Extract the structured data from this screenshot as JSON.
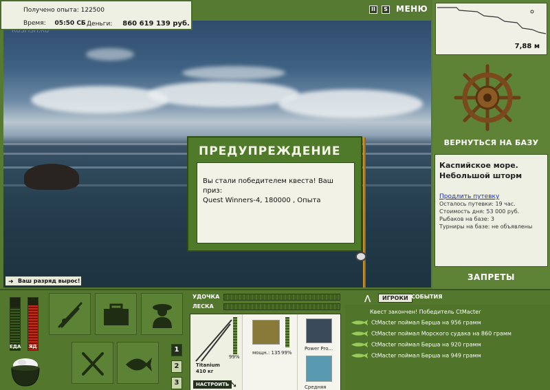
{
  "stats": {
    "xp_label": "Получено опыта:",
    "xp_value": "122500",
    "time_label": "Время:",
    "time_value": "05:50 СБ",
    "money_label": "Деньги:",
    "money_value": "860 619 139 руб."
  },
  "scene": {
    "watermark": "RUSFISH.RU"
  },
  "controls": {
    "pause": "II",
    "sound": "S",
    "menu": "МЕНЮ"
  },
  "depth": {
    "value": "7,88 м"
  },
  "base": {
    "return_label": "ВЕРНУТЬСЯ НА БАЗУ"
  },
  "location": {
    "title_line1": "Каспийское море.",
    "title_line2": "Небольшой шторм",
    "extend_link": "Продлить путевку",
    "lines": [
      "Осталось путевки: 19 час.",
      "Стоимость дня: 53 000 руб.",
      "Рыбаков на базе: 3",
      "Турниры на базе: не объявлены"
    ]
  },
  "bans_label": "ЗАПРЕТЫ",
  "dialog": {
    "title": "ПРЕДУПРЕЖДЕНИЕ",
    "message_line1": "Вы стали победителем квеста! Ваш приз:",
    "message_line2": "Quest Winners-4, 180000 , Опыта"
  },
  "rank_notice": "Ваш разряд вырос!",
  "meters": {
    "food_label": "ЕДА",
    "poison_label": "ЯД",
    "food_level": 0.82,
    "poison_level": 0.85
  },
  "slot_numbers": [
    "1",
    "2",
    "3"
  ],
  "tackle": {
    "rod_label": "УДОЧКА",
    "line_label": "ЛЕСКА",
    "rod_name": "Titanium",
    "rod_weight": "410 кг",
    "rod_pct": "99%",
    "reel_info": "мощн.: 135",
    "reel_pct": "99%",
    "line_name": "Power Pro...",
    "lure_name": "Средняя",
    "setup_button": "НАСТРОИТЬ"
  },
  "feed": {
    "tab_players": "ИГРОКИ",
    "tab_events": "СОБЫТИЯ",
    "lines": [
      "Квест закончен! Победитель CtMacter",
      "CtMacter поймал Берша на 956 грамм",
      "CtMacter поймал Морского судака на 860 грамм",
      "CtMacter поймал Берша на 920 грамм",
      "CtMacter поймал Берша на 949 грамм"
    ]
  },
  "colors": {
    "panel_green": "#567a32",
    "dialog_green": "#4f7a2a",
    "link_blue": "#1a2fb0"
  }
}
